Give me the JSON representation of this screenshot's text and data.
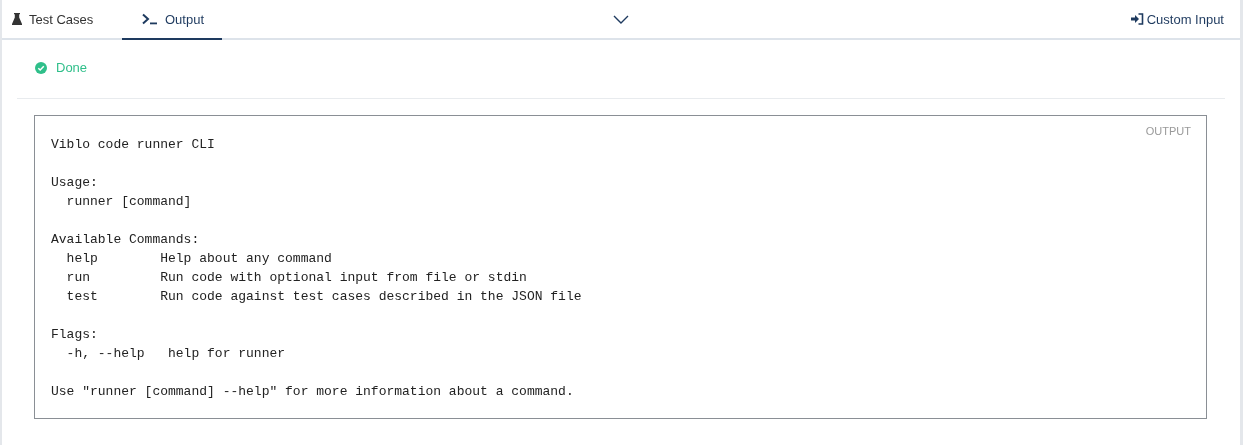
{
  "tabs": [
    {
      "label": "Test Cases",
      "kind": "flask",
      "selected": false
    },
    {
      "label": "Output",
      "kind": "terminal",
      "selected": true
    }
  ],
  "custom_input": "Custom Input",
  "status": {
    "label": "Done",
    "kind": "success"
  },
  "output": {
    "badge": "OUTPUT",
    "sections": [
      [
        "Viblo code runner CLI"
      ],
      [
        "Usage:",
        "  runner [command]"
      ],
      [
        "Available Commands:",
        "  help        Help about any command",
        "  run         Run code with optional input from file or stdin",
        "  test        Run code against test cases described in the JSON file"
      ],
      [
        "Flags:",
        "  -h, --help   help for runner"
      ],
      [
        "Use \"runner [command] --help\" for more information about a command."
      ]
    ]
  }
}
